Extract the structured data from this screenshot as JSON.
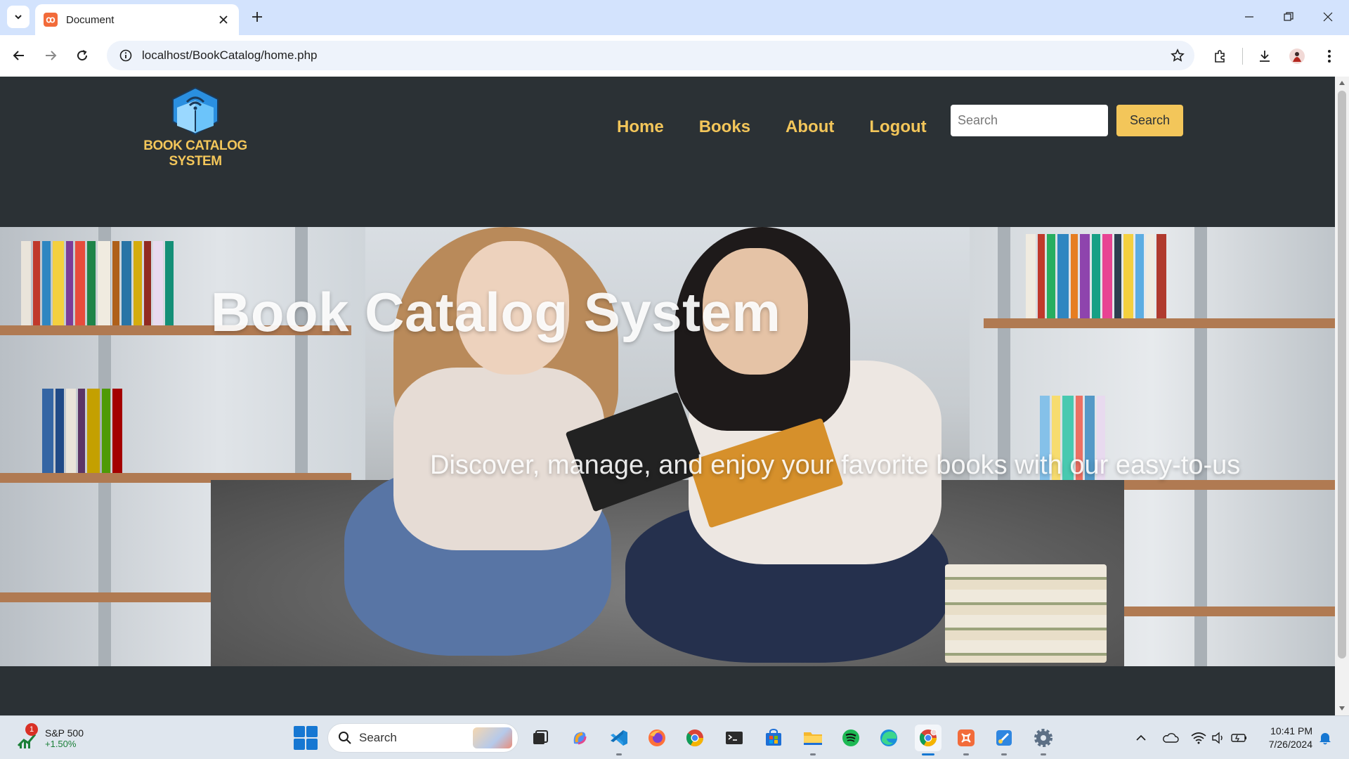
{
  "browser": {
    "tab_title": "Document",
    "url": "localhost/BookCatalog/home.php",
    "icons": {
      "tab_menu": "chevron-down-icon",
      "favicon": "xampp-icon",
      "tab_close": "close-icon",
      "new_tab": "plus-icon",
      "back": "arrow-left-icon",
      "forward": "arrow-right-icon",
      "reload": "reload-icon",
      "site_info": "info-icon",
      "bookmark": "star-icon",
      "extensions": "puzzle-icon",
      "downloads": "download-icon",
      "profile": "avatar-icon",
      "menu": "more-vertical-icon"
    }
  },
  "site": {
    "logo_text": "BOOK CATALOG SYSTEM",
    "nav": [
      {
        "label": "Home"
      },
      {
        "label": "Books"
      },
      {
        "label": "About"
      },
      {
        "label": "Logout"
      }
    ],
    "search": {
      "placeholder": "Search",
      "value": "",
      "button_label": "Search"
    },
    "hero": {
      "title": "Book Catalog System",
      "subtitle": "Discover, manage, and enjoy your favorite books with our easy-to-us"
    },
    "colors": {
      "background": "#2b3135",
      "accent": "#f3c65a",
      "logo_blue": "#4fb3f6"
    }
  },
  "taskbar": {
    "widget": {
      "name": "S&P 500",
      "change": "+1.50%",
      "badge": "1"
    },
    "search_label": "Search",
    "apps": [
      "task-view-icon",
      "copilot-icon",
      "vscode-icon",
      "firefox-icon",
      "chrome-icon",
      "terminal-icon",
      "store-icon",
      "file-explorer-icon",
      "spotify-icon",
      "edge-icon",
      "chrome-profile-icon",
      "xampp-icon",
      "paint-icon",
      "settings-icon"
    ],
    "tray": [
      "chevron-up-icon",
      "onedrive-icon",
      "wifi-icon",
      "volume-icon",
      "battery-icon"
    ],
    "clock": {
      "time": "10:41 PM",
      "date": "7/26/2024"
    }
  }
}
